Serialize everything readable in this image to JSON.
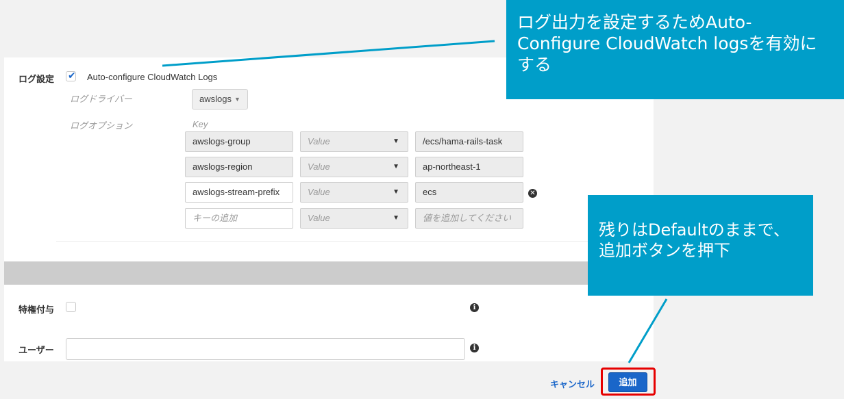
{
  "log_settings": {
    "label": "ログ設定",
    "auto_configure_checked": true,
    "auto_configure_label": "Auto-configure CloudWatch Logs",
    "log_driver_label": "ログドライバー",
    "log_driver_value": "awslogs",
    "log_options_label": "ログオプション",
    "key_header": "Key",
    "options": [
      {
        "key": "awslogs-group",
        "value_type": "Value",
        "value": "/ecs/hama-rails-task"
      },
      {
        "key": "awslogs-region",
        "value_type": "Value",
        "value": "ap-northeast-1"
      },
      {
        "key": "awslogs-stream-prefix",
        "value_type": "Value",
        "value": "ecs"
      }
    ],
    "new_option": {
      "key_placeholder": "キーの追加",
      "value_type": "Value",
      "value_placeholder": "値を追加してください"
    }
  },
  "privileged": {
    "label": "特権付与",
    "checked": false
  },
  "user": {
    "label": "ユーザー",
    "value": ""
  },
  "footer": {
    "cancel_label": "キャンセル",
    "add_label": "追加"
  },
  "annotations": {
    "callout_top": "ログ出力を設定するためAuto-Configure CloudWatch logsを有効にする",
    "callout_bottom": "残りはDefaultのままで、追加ボタンを押下",
    "color": "#009ec9",
    "highlight_color": "#e60000"
  },
  "colors": {
    "accent": "#1a66c9"
  }
}
